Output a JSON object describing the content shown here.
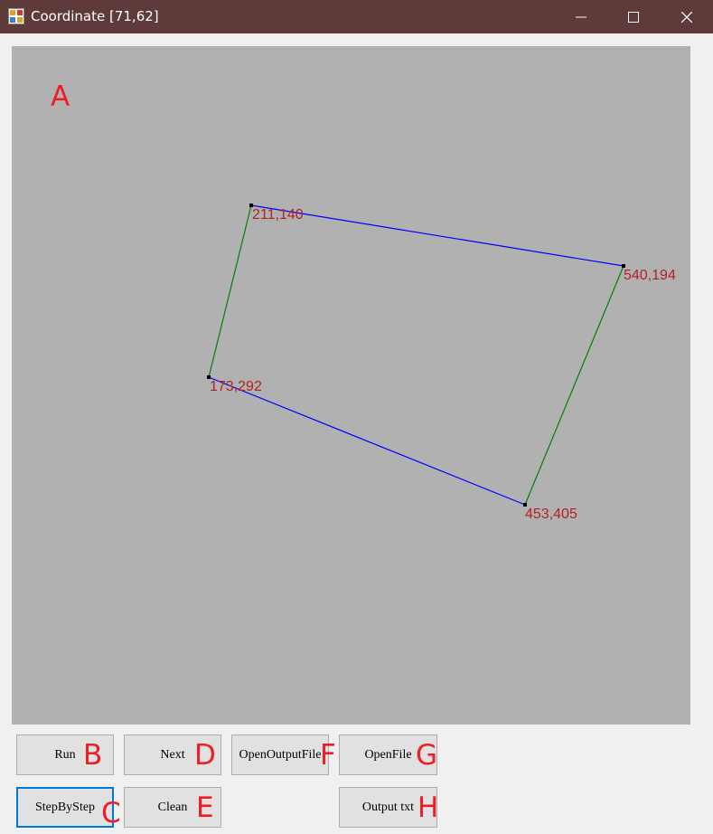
{
  "window": {
    "title": "Coordinate [71,62]",
    "minimize_glyph": "—",
    "maximize_glyph": "□",
    "close_glyph": "✕"
  },
  "canvas": {
    "background": "#b1b1b1",
    "points": [
      {
        "label": "211,140"
      },
      {
        "label": "540,194"
      },
      {
        "label": "453,405"
      },
      {
        "label": "173,292"
      }
    ],
    "edge_colors": {
      "horizontal": "#0000ff",
      "vertical": "#008000"
    },
    "label_color": "#b22222"
  },
  "annotations": [
    "A",
    "B",
    "C",
    "D",
    "E",
    "F",
    "G",
    "H"
  ],
  "buttons": {
    "run": "Run",
    "next": "Next",
    "open_output_file": "OpenOutputFile",
    "open_file": "OpenFile",
    "step_by_step": "StepByStep",
    "clean": "Clean",
    "output_txt": "Output txt"
  },
  "colors": {
    "titlebar": "#5f3a3a",
    "annotation": "#ee1c24",
    "focus": "#0078d7"
  }
}
